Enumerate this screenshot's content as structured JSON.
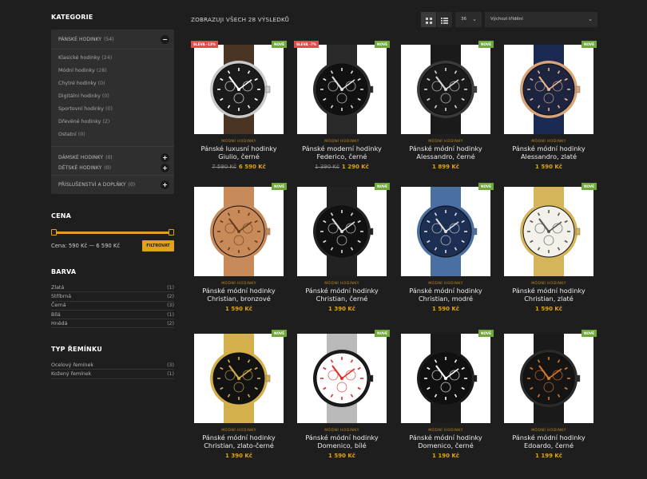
{
  "sidebar": {
    "categories_title": "KATEGORIE",
    "categories": {
      "main": {
        "label": "PÁNSKÉ HODINKY",
        "count": "(54)",
        "toggle": "−"
      },
      "sub": [
        {
          "label": "Klasické hodinky",
          "count": "(24)"
        },
        {
          "label": "Módní hodinky",
          "count": "(28)"
        },
        {
          "label": "Chytré hodinky",
          "count": "(0)"
        },
        {
          "label": "Digitální hodinky",
          "count": "(0)"
        },
        {
          "label": "Sportovní hodinky",
          "count": "(0)"
        },
        {
          "label": "Dřevěné hodinky",
          "count": "(2)"
        },
        {
          "label": "Ostatní",
          "count": "(0)"
        }
      ],
      "others": [
        {
          "label": "DÁMSKÉ HODINKY",
          "count": "(0)",
          "toggle": "+"
        },
        {
          "label": "DĚTSKÉ HODINKY",
          "count": "(0)",
          "toggle": "+"
        },
        {
          "label": "PŘÍSLUŠENSTVÍ A DOPLŇKY",
          "count": "(0)",
          "toggle": "+"
        }
      ]
    },
    "price": {
      "title": "CENA",
      "range_text": "Cena: 590 Kč — 6 590 Kč",
      "filter_button": "FILTROVAT"
    },
    "color": {
      "title": "BARVA",
      "items": [
        {
          "label": "Zlatá",
          "count": "(1)"
        },
        {
          "label": "Stříbrná",
          "count": "(2)"
        },
        {
          "label": "Černá",
          "count": "(3)"
        },
        {
          "label": "Bílá",
          "count": "(1)"
        },
        {
          "label": "Hnědá",
          "count": "(2)"
        }
      ]
    },
    "strap": {
      "title": "TYP ŘEMÍNKU",
      "items": [
        {
          "label": "Ocelový řemínek",
          "count": "(3)"
        },
        {
          "label": "Kožený řemínek",
          "count": "(1)"
        }
      ]
    }
  },
  "toolbar": {
    "results_text": "ZOBRAZUJI VŠECH 28 VÝSLEDKŮ",
    "per_page": "36",
    "sort": "Výchozí třídění"
  },
  "products": [
    {
      "badge_sale": "SLEVA -13%",
      "badge_new": "NOVÉ",
      "category": "MÓDNÍ HODINKY",
      "name": "Pánské luxusní hodinky Giulio, černé",
      "old_price": "7 590 Kč",
      "price": "6 590 Kč",
      "dial": "#1b1b1b",
      "case": "#c9c9c9",
      "strap": "#4a3424",
      "hands": "#ffffff"
    },
    {
      "badge_sale": "SLEVA -7%",
      "badge_new": "NOVÉ",
      "category": "MÓDNÍ HODINKY",
      "name": "Pánské moderní hodinky Federico, černé",
      "old_price": "1 390 Kč",
      "price": "1 290 Kč",
      "dial": "#111111",
      "case": "#2a2a2a",
      "strap": "#2a2a2a",
      "hands": "#e0e0e0"
    },
    {
      "badge_sale": "",
      "badge_new": "NOVÉ",
      "category": "MÓDNÍ HODINKY",
      "name": "Pánské módní hodinky Alessandro, černé",
      "old_price": "",
      "price": "1 899 Kč",
      "dial": "#1a1a1a",
      "case": "#3a3a3a",
      "strap": "#1a1a1a",
      "hands": "#d9d9d9"
    },
    {
      "badge_sale": "",
      "badge_new": "NOVÉ",
      "category": "MÓDNÍ HODINKY",
      "name": "Pánské módní hodinky Alessandro, zlaté",
      "old_price": "",
      "price": "1 590 Kč",
      "dial": "#1c2440",
      "case": "#d8a47a",
      "strap": "#1b2a52",
      "hands": "#e8b890"
    },
    {
      "badge_sale": "",
      "badge_new": "NOVÉ",
      "category": "MÓDNÍ HODINKY",
      "name": "Pánské módní hodinky Christian, bronzové",
      "old_price": "",
      "price": "1 590 Kč",
      "dial": "#c98a5a",
      "case": "#c98a5a",
      "strap": "#c98a5a",
      "hands": "#6a3a1a"
    },
    {
      "badge_sale": "",
      "badge_new": "NOVÉ",
      "category": "MÓDNÍ HODINKY",
      "name": "Pánské módní hodinky Christian, černé",
      "old_price": "",
      "price": "1 390 Kč",
      "dial": "#111111",
      "case": "#222222",
      "strap": "#222222",
      "hands": "#e0e0e0"
    },
    {
      "badge_sale": "",
      "badge_new": "NOVÉ",
      "category": "MÓDNÍ HODINKY",
      "name": "Pánské módní hodinky Christian, modré",
      "old_price": "",
      "price": "1 590 Kč",
      "dial": "#1c2e52",
      "case": "#4a6fa3",
      "strap": "#4a6fa3",
      "hands": "#e0e0e0"
    },
    {
      "badge_sale": "",
      "badge_new": "NOVÉ",
      "category": "MÓDNÍ HODINKY",
      "name": "Pánské módní hodinky Christian, zlaté",
      "old_price": "",
      "price": "1 590 Kč",
      "dial": "#f4f1ea",
      "case": "#d6b55a",
      "strap": "#d6b55a",
      "hands": "#555555"
    },
    {
      "badge_sale": "",
      "badge_new": "NOVÉ",
      "category": "MÓDNÍ HODINKY",
      "name": "Pánské módní hodinky Christian, zlato-černé",
      "old_price": "",
      "price": "1 390 Kč",
      "dial": "#121212",
      "case": "#d4b04d",
      "strap": "#d4b04d",
      "hands": "#d4b04d"
    },
    {
      "badge_sale": "",
      "badge_new": "NOVÉ",
      "category": "MÓDNÍ HODINKY",
      "name": "Pánské módní hodinky Domenico, bílé",
      "old_price": "",
      "price": "1 590 Kč",
      "dial": "#ffffff",
      "case": "#1a1a1a",
      "strap": "#b9b9b9",
      "hands": "#d9302a"
    },
    {
      "badge_sale": "",
      "badge_new": "NOVÉ",
      "category": "MÓDNÍ HODINKY",
      "name": "Pánské módní hodinky Domenico, černé",
      "old_price": "",
      "price": "1 190 Kč",
      "dial": "#101010",
      "case": "#1a1a1a",
      "strap": "#1a1a1a",
      "hands": "#ffffff"
    },
    {
      "badge_sale": "",
      "badge_new": "NOVÉ",
      "category": "MÓDNÍ HODINKY",
      "name": "Pánské módní hodinky Edoardo, černé",
      "old_price": "",
      "price": "1 199 Kč",
      "dial": "#141414",
      "case": "#2a2a2a",
      "strap": "#1a1a1a",
      "hands": "#d97a2a"
    }
  ],
  "colors": {
    "accent": "#e0a11f",
    "new_badge": "#6fa83b",
    "sale_badge": "#e34a4a",
    "background": "#1e1e1e"
  },
  "icons": {
    "grid_view": "grid-icon",
    "list_view": "list-icon",
    "chevron": "chevron-down-icon"
  }
}
